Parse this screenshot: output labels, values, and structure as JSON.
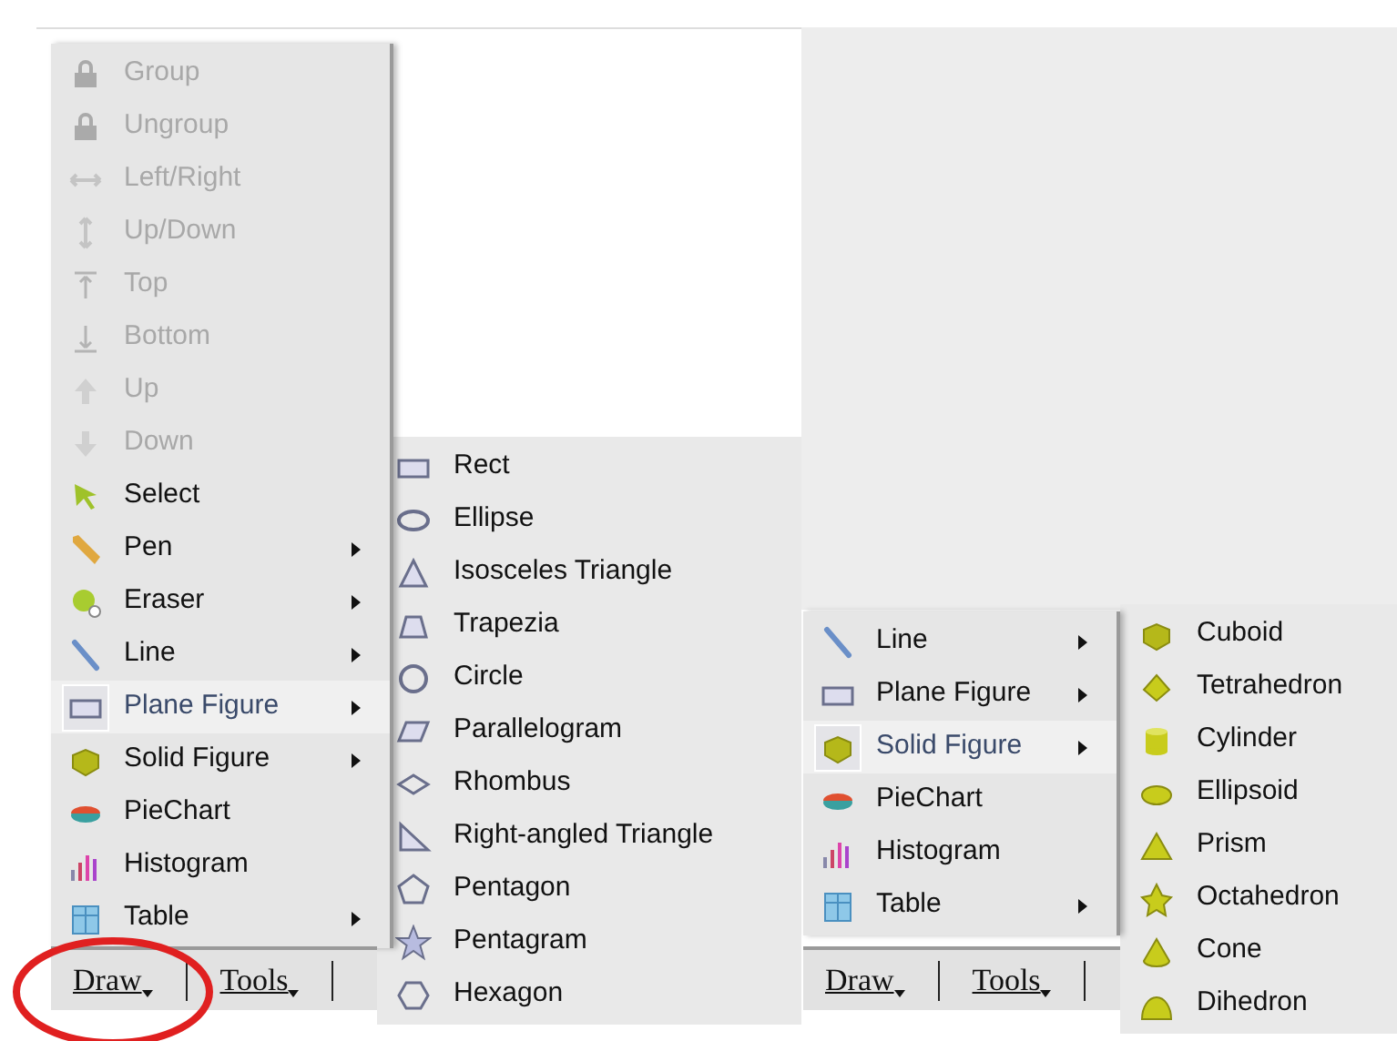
{
  "left_screen": {
    "menu": [
      {
        "label": "Group",
        "disabled": true,
        "selected": false,
        "has_submenu": false
      },
      {
        "label": "Ungroup",
        "disabled": true,
        "selected": false,
        "has_submenu": false
      },
      {
        "label": "Left/Right",
        "disabled": true,
        "selected": false,
        "has_submenu": false
      },
      {
        "label": "Up/Down",
        "disabled": true,
        "selected": false,
        "has_submenu": false
      },
      {
        "label": "Top",
        "disabled": true,
        "selected": false,
        "has_submenu": false
      },
      {
        "label": "Bottom",
        "disabled": true,
        "selected": false,
        "has_submenu": false
      },
      {
        "label": "Up",
        "disabled": true,
        "selected": false,
        "has_submenu": false
      },
      {
        "label": "Down",
        "disabled": true,
        "selected": false,
        "has_submenu": false
      },
      {
        "label": "Select",
        "disabled": false,
        "selected": false,
        "has_submenu": false
      },
      {
        "label": "Pen",
        "disabled": false,
        "selected": false,
        "has_submenu": true
      },
      {
        "label": "Eraser",
        "disabled": false,
        "selected": false,
        "has_submenu": true
      },
      {
        "label": "Line",
        "disabled": false,
        "selected": false,
        "has_submenu": true
      },
      {
        "label": "Plane Figure",
        "disabled": false,
        "selected": true,
        "has_submenu": true
      },
      {
        "label": "Solid Figure",
        "disabled": false,
        "selected": false,
        "has_submenu": true
      },
      {
        "label": "PieChart",
        "disabled": false,
        "selected": false,
        "has_submenu": false
      },
      {
        "label": "Histogram",
        "disabled": false,
        "selected": false,
        "has_submenu": false
      },
      {
        "label": "Table",
        "disabled": false,
        "selected": false,
        "has_submenu": true
      }
    ],
    "submenu": [
      {
        "label": "Rect"
      },
      {
        "label": "Ellipse"
      },
      {
        "label": "Isosceles Triangle"
      },
      {
        "label": "Trapezia"
      },
      {
        "label": "Circle"
      },
      {
        "label": "Parallelogram"
      },
      {
        "label": "Rhombus"
      },
      {
        "label": "Right-angled Triangle"
      },
      {
        "label": "Pentagon"
      },
      {
        "label": "Pentagram"
      },
      {
        "label": "Hexagon"
      }
    ],
    "toolbar": [
      {
        "label": "Draw"
      },
      {
        "label": "Tools"
      }
    ]
  },
  "right_screen": {
    "menu": [
      {
        "label": "Line",
        "disabled": false,
        "selected": false,
        "has_submenu": true
      },
      {
        "label": "Plane Figure",
        "disabled": false,
        "selected": false,
        "has_submenu": true
      },
      {
        "label": "Solid Figure",
        "disabled": false,
        "selected": true,
        "has_submenu": true
      },
      {
        "label": "PieChart",
        "disabled": false,
        "selected": false,
        "has_submenu": false
      },
      {
        "label": "Histogram",
        "disabled": false,
        "selected": false,
        "has_submenu": false
      },
      {
        "label": "Table",
        "disabled": false,
        "selected": false,
        "has_submenu": true
      }
    ],
    "submenu": [
      {
        "label": "Cuboid"
      },
      {
        "label": "Tetrahedron"
      },
      {
        "label": "Cylinder"
      },
      {
        "label": "Ellipsoid"
      },
      {
        "label": "Prism"
      },
      {
        "label": "Octahedron"
      },
      {
        "label": "Cone"
      },
      {
        "label": "Dihedron"
      }
    ],
    "toolbar": [
      {
        "label": "Draw"
      },
      {
        "label": "Tools"
      }
    ]
  }
}
